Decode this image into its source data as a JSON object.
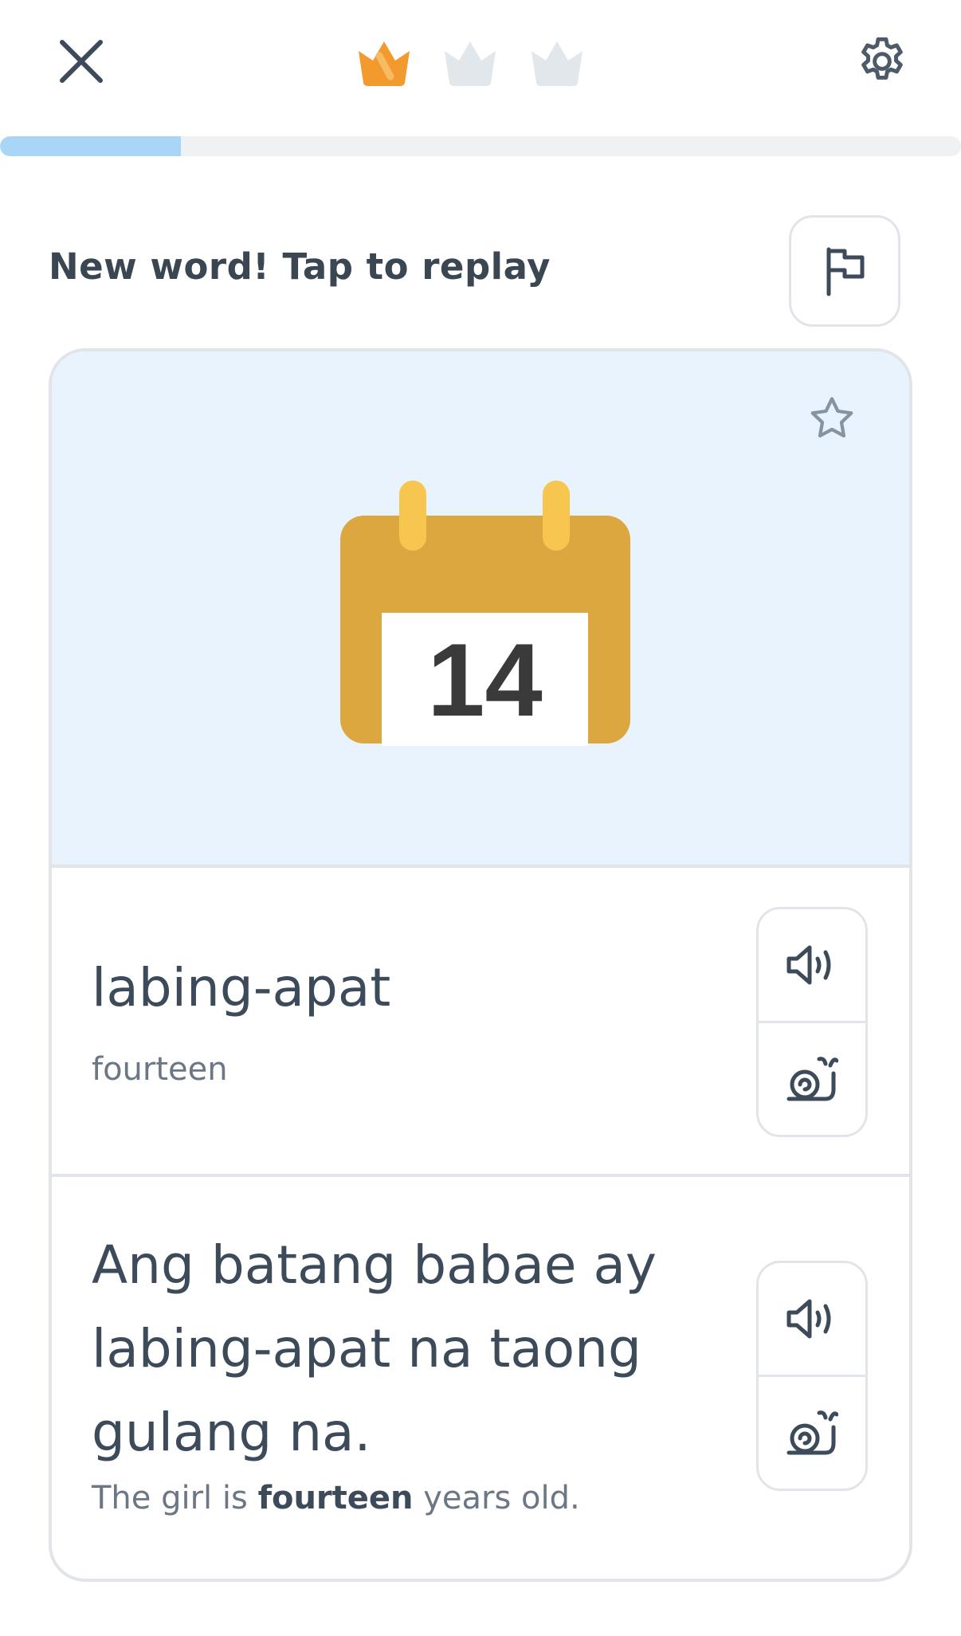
{
  "header": {
    "close_icon": "close-icon",
    "settings_icon": "gear-icon",
    "crowns": [
      {
        "state": "earned",
        "color": "#f39a2e"
      },
      {
        "state": "empty",
        "color": "#e2e7ec"
      },
      {
        "state": "empty",
        "color": "#e2e7ec"
      }
    ]
  },
  "progress": {
    "fraction": 0.188,
    "color": "#a9d6f7"
  },
  "prompt": {
    "text": "New word! Tap to replay",
    "report_icon": "flag-icon"
  },
  "card": {
    "image": {
      "calendar_number": "14",
      "star_icon": "star-icon"
    },
    "word": {
      "text": "labing-apat",
      "translation": "fourteen"
    },
    "sentence": {
      "text": "Ang batang babae ay labing-apat na taong gulang na.",
      "translation_before": "The girl is ",
      "translation_bold": "fourteen",
      "translation_after": " years old."
    },
    "audio_icons": {
      "normal": "speaker-icon",
      "slow": "snail-icon"
    }
  }
}
